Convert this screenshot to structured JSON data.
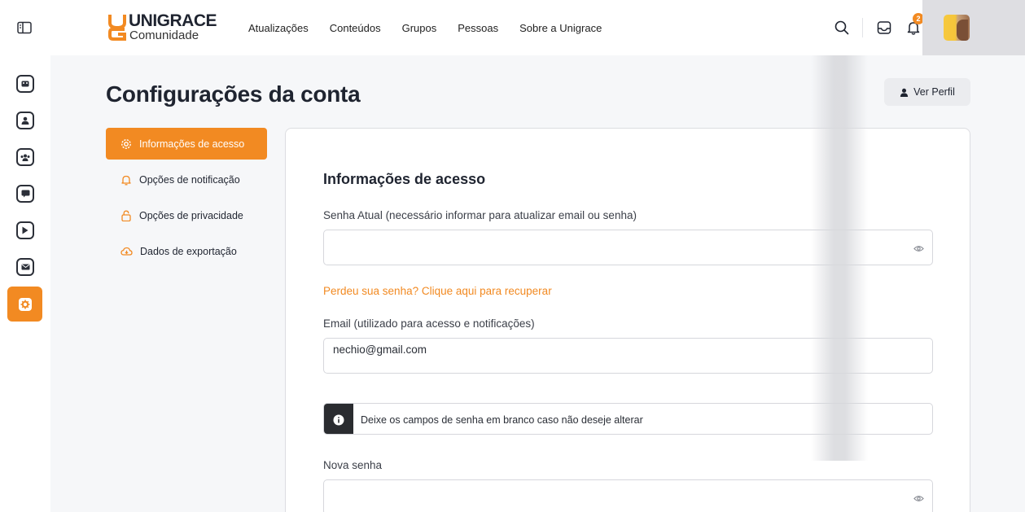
{
  "brand": {
    "name": "UNIGRACE",
    "subtitle": "Comunidade",
    "accent": "#f28a22"
  },
  "header": {
    "nav": [
      "Atualizações",
      "Conteúdos",
      "Grupos",
      "Pessoas",
      "Sobre a Unigrace"
    ],
    "notification_count": "2",
    "icons": [
      "sidebar-toggle-icon",
      "search-icon",
      "inbox-icon",
      "bell-icon"
    ]
  },
  "rail": {
    "items": [
      "news-icon",
      "profile-icon",
      "groups-icon",
      "forum-icon",
      "video-icon",
      "mail-icon",
      "settings-icon"
    ],
    "active": "settings-icon"
  },
  "page": {
    "title": "Configurações da conta",
    "ver_perfil": "Ver Perfil"
  },
  "settings_nav": [
    {
      "label": "Informações de acesso",
      "icon": "gear-icon",
      "active": true
    },
    {
      "label": "Opções de notificação",
      "icon": "bell-icon",
      "active": false
    },
    {
      "label": "Opções de privacidade",
      "icon": "lock-icon",
      "active": false
    },
    {
      "label": "Dados de exportação",
      "icon": "cloud-download-icon",
      "active": false
    }
  ],
  "form": {
    "title": "Informações de acesso",
    "current_password_label": "Senha Atual (necessário informar para atualizar email ou senha)",
    "current_password_value": "",
    "recover_link": "Perdeu sua senha? Clique aqui para recuperar",
    "email_label": "Email (utilizado para acesso e notificações)",
    "email_value": "nechio@gmail.com",
    "notice": "Deixe os campos de senha em branco caso não deseje alterar",
    "new_password_label": "Nova senha",
    "new_password_value": ""
  }
}
